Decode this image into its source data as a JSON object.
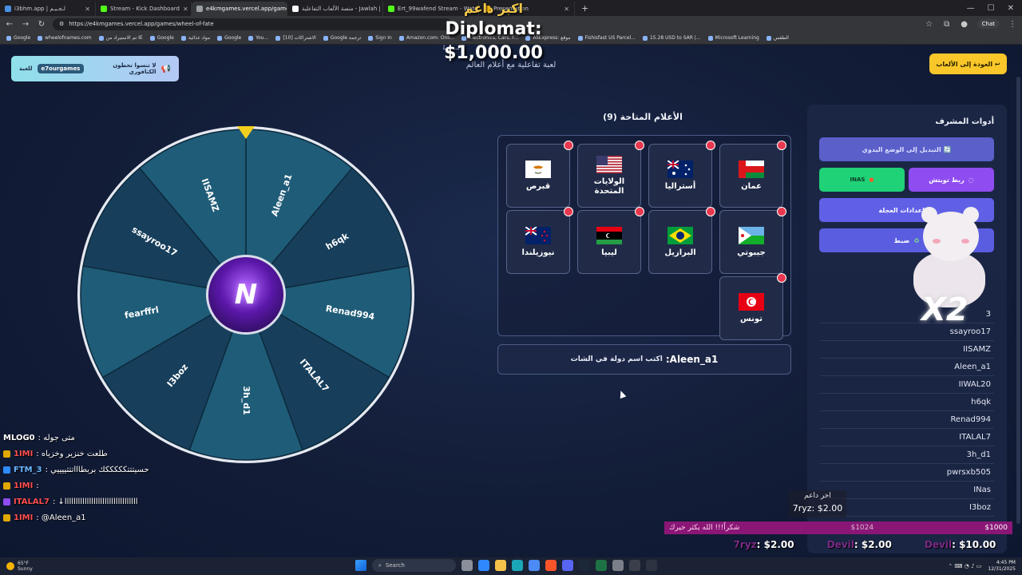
{
  "browser": {
    "tabs": [
      {
        "title": "i3bhm.app | لـجـيـم",
        "color": "#4a90e2"
      },
      {
        "title": "Stream - Kick Dashboard",
        "color": "#53fc18"
      },
      {
        "title": "e4kmgames.vercel.app/games/w...",
        "color": "#9aa0a6",
        "active": true
      },
      {
        "title": "منصة الألعاب التفاعلية - Jawlah | جولة",
        "color": "#ffffff"
      },
      {
        "title": "Ert_99wafend Stream - Watch Li...",
        "color": "#53fc18"
      },
      {
        "title": "Presentation",
        "color": "#f4b400"
      }
    ],
    "url": "https://e4kmgames.vercel.app/games/wheel-of-fate",
    "chat_label": "Chat",
    "bookmarks": [
      "Google",
      "wheelofnames.com",
      "تم الاستيراد من IE",
      "Google",
      "مواد غذائية",
      "Google",
      "You...",
      "[10] الاشتراكات",
      "Google ترجمة",
      "Sign In",
      "Amazon.com: Onli...",
      "Electronics, Cars, F...",
      "AliExpress: موقع",
      "Fishisfast US Parcel...",
      "15.28 USD to SAR |...",
      "Microsoft Learning",
      "الطقس"
    ]
  },
  "page": {
    "subtitle": "لعبة تفاعلية مع أعلام العالم",
    "reminder": {
      "text": "لا تنسوا تحطون الكنافوري",
      "chip": "e7ourgames",
      "suffix": "للعبة"
    },
    "back_button": "العودة إلى الألعاب ↩"
  },
  "wheel": {
    "segments": [
      "Aleen_a1",
      "h6qk",
      "Renad994",
      "ITALAL7",
      "3h_d1",
      "I3boz",
      "fearffrl",
      "ssayroo17",
      "IISAMZ"
    ],
    "hub_letter": "N",
    "colors": [
      "#1f5c78",
      "#173f5c",
      "#1f5c78",
      "#173f5c",
      "#1f5c78",
      "#173f5c",
      "#1f5c78",
      "#173f5c",
      "#1f5c78"
    ]
  },
  "flags": {
    "title": "الأعلام المتاحة (9)",
    "items": [
      {
        "name": "عمان",
        "flag": "oman"
      },
      {
        "name": "أستراليا",
        "flag": "australia"
      },
      {
        "name": "الولايات المتحدة",
        "flag": "usa"
      },
      {
        "name": "قبرص",
        "flag": "cyprus"
      },
      {
        "name": "جيبوتي",
        "flag": "djibouti"
      },
      {
        "name": "البرازيل",
        "flag": "brazil"
      },
      {
        "name": "ليبيا",
        "flag": "libya"
      },
      {
        "name": "نيوزيلندا",
        "flag": "newzealand"
      },
      {
        "name": "تونس",
        "flag": "tunisia"
      }
    ]
  },
  "chat_hint": {
    "user": "Aleen_a1:",
    "text": "اكتب اسم دولة في الشات"
  },
  "admin": {
    "title": "أدوات المشرف",
    "manual_mode": "التبديل إلى الوضع اليدوي 🔄",
    "twitch": "ربط تويتش",
    "inas": "INAS",
    "settings": "إعدادات العجلة ⚙️",
    "reset": "ضبط"
  },
  "players": [
    "3",
    "ssayroo17",
    "IISAMZ",
    "Aleen_a1",
    "IIWAL20",
    "h6qk",
    "Renad994",
    "ITALAL7",
    "3h_d1",
    "pwrsxb505",
    "INas",
    "I3boz"
  ],
  "overlay": {
    "top_donor_label": "اكبر داعم",
    "top_donor_value": "Diplomat: $1,000.00",
    "sticker_text": "X2",
    "last_donor_label": "اخر داعم",
    "last_donor_value": "7ryz: $2.00",
    "donation_bar": {
      "thanks": "شكراً!!! الله يكثر خيرك",
      "mid": "$1024",
      "right": "$1000"
    },
    "ticker": [
      {
        "name": "7ryz",
        "amount": ": $2.00"
      },
      {
        "name": "Devil",
        "amount": ": $2.00"
      },
      {
        "name": "Devil",
        "amount": ": $10.00"
      }
    ]
  },
  "stream_chat": [
    {
      "user": "MLOG0",
      "text": ": متى جوله",
      "color": "#ffffff",
      "badge": ""
    },
    {
      "user": "1IMI",
      "text": ": طلعت خنزير وخزياه",
      "color": "#ff4d4d",
      "badge": "#e0a800"
    },
    {
      "user": "FTM_3",
      "text": ": حسيتتتكككككك بربطاااتتتييييي",
      "color": "#6ab7ff",
      "badge": "#2e8bff"
    },
    {
      "user": "1IMI",
      "text": ":",
      "color": "#ff4d4d",
      "badge": "#e0a800"
    },
    {
      "user": "ITALAL7",
      "text": ": ↓ااااااااااااااااااااااااااااااااا",
      "color": "#ff4d4d",
      "badge": "#8f4cf0"
    },
    {
      "user": "1IMI",
      "text": ": @Aleen_a1",
      "color": "#ff4d4d",
      "badge": "#e0a800"
    }
  ],
  "taskbar": {
    "weather_temp": "65°F",
    "weather_desc": "Sunny",
    "search_placeholder": "Search",
    "time": "4:45 PM",
    "date": "12/31/2025"
  }
}
